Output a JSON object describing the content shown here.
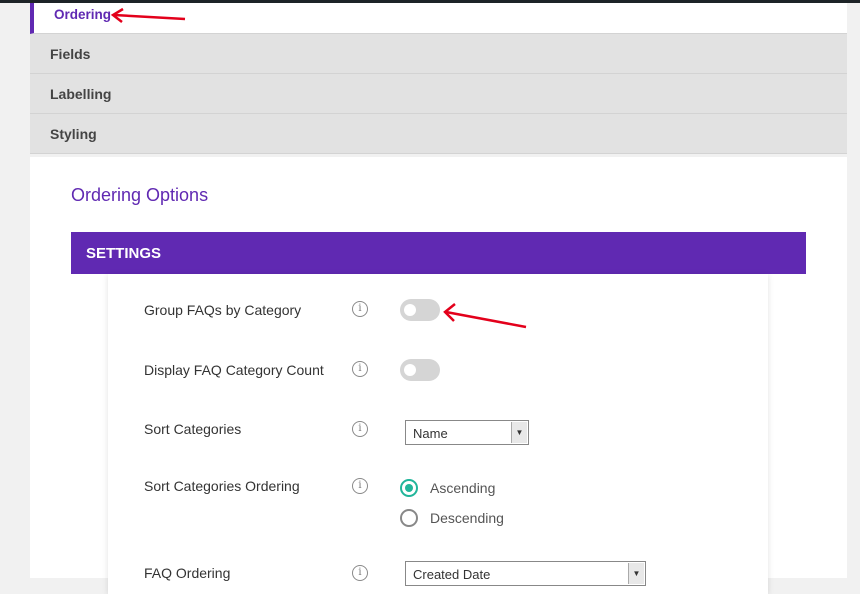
{
  "tabs": [
    {
      "label": "Ordering"
    },
    {
      "label": "Fields"
    },
    {
      "label": "Labelling"
    },
    {
      "label": "Styling"
    }
  ],
  "section_title": "Ordering Options",
  "settings_header": "SETTINGS",
  "settings": {
    "group_by_category": {
      "label": "Group FAQs by Category",
      "enabled": false
    },
    "display_category_count": {
      "label": "Display FAQ Category Count",
      "enabled": false
    },
    "sort_categories": {
      "label": "Sort Categories",
      "value": "Name"
    },
    "sort_categories_ordering": {
      "label": "Sort Categories Ordering",
      "options": [
        "Ascending",
        "Descending"
      ],
      "selected": "Ascending"
    },
    "faq_ordering": {
      "label": "FAQ Ordering",
      "value": "Created Date"
    }
  },
  "icons": {
    "info": "info-icon",
    "annotation": "red-arrow-annotation"
  },
  "colors": {
    "accent": "#6029b2",
    "radio_checked": "#21b59a",
    "annotation": "#e3001b"
  }
}
